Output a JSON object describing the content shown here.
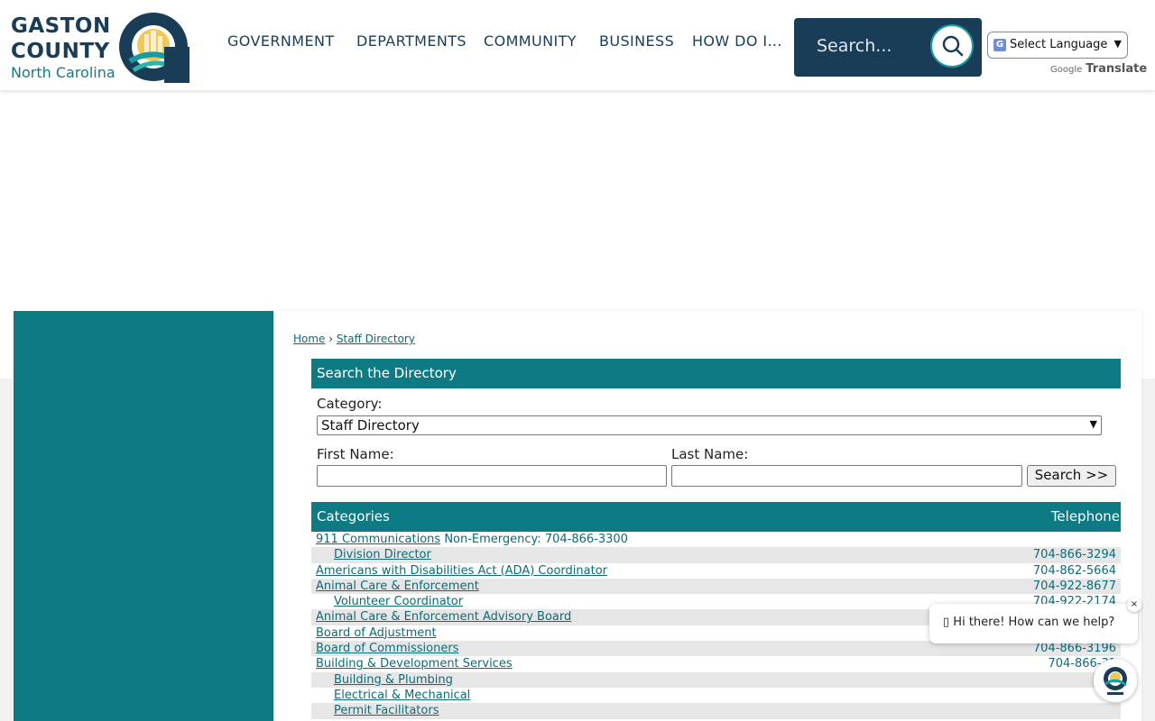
{
  "header": {
    "logo": {
      "line1": "GASTON",
      "line2": "COUNTY",
      "line3": "North Carolina"
    },
    "nav": [
      "GOVERNMENT",
      "DEPARTMENTS",
      "COMMUNITY",
      "BUSINESS",
      "HOW DO I..."
    ],
    "search_placeholder": "Search...",
    "language": {
      "label": "Select Language",
      "powered_by": "Google",
      "translate": "Translate"
    }
  },
  "breadcrumb": {
    "home": "Home",
    "current": "Staff Directory"
  },
  "search_panel": {
    "title": "Search the Directory",
    "category_label": "Category:",
    "category_value": "Staff Directory",
    "first_name_label": "First Name:",
    "last_name_label": "Last Name:",
    "search_button": "Search >>"
  },
  "table": {
    "header_left": "Categories",
    "header_right": "Telephone",
    "rows": [
      {
        "name": "911 Communications",
        "note": " Non-Emergency: 704-866-3300",
        "tel": "",
        "indent": false
      },
      {
        "name": "Division Director",
        "note": "",
        "tel": "704-866-3294",
        "indent": true
      },
      {
        "name": "Americans with Disabilities Act (ADA) Coordinator",
        "note": "",
        "tel": "704-862-5664",
        "indent": false
      },
      {
        "name": "Animal Care & Enforcement",
        "note": "",
        "tel": "704-922-8677",
        "indent": false
      },
      {
        "name": "Volunteer Coordinator",
        "note": "",
        "tel": "704-922-2174",
        "indent": true
      },
      {
        "name": "Animal Care & Enforcement Advisory Board",
        "note": "",
        "tel": "",
        "indent": false
      },
      {
        "name": "Board of Adjustment",
        "note": "",
        "tel": "",
        "indent": false
      },
      {
        "name": "Board of Commissioners",
        "note": "",
        "tel": "704-866-3196",
        "indent": false
      },
      {
        "name": "Building & Development Services",
        "note": "",
        "tel": "704-866-31",
        "indent": false
      },
      {
        "name": "Building & Plumbing",
        "note": "",
        "tel": "",
        "indent": true
      },
      {
        "name": "Electrical & Mechanical",
        "note": "",
        "tel": "",
        "indent": true
      },
      {
        "name": "Permit Facilitators",
        "note": "",
        "tel": "",
        "indent": true
      }
    ]
  },
  "chat": {
    "greeting": "Hi there! How can we help?",
    "close": "×"
  },
  "colors": {
    "teal": "#0d7a84",
    "navy": "#1a3d57",
    "link": "#0d6b77"
  }
}
